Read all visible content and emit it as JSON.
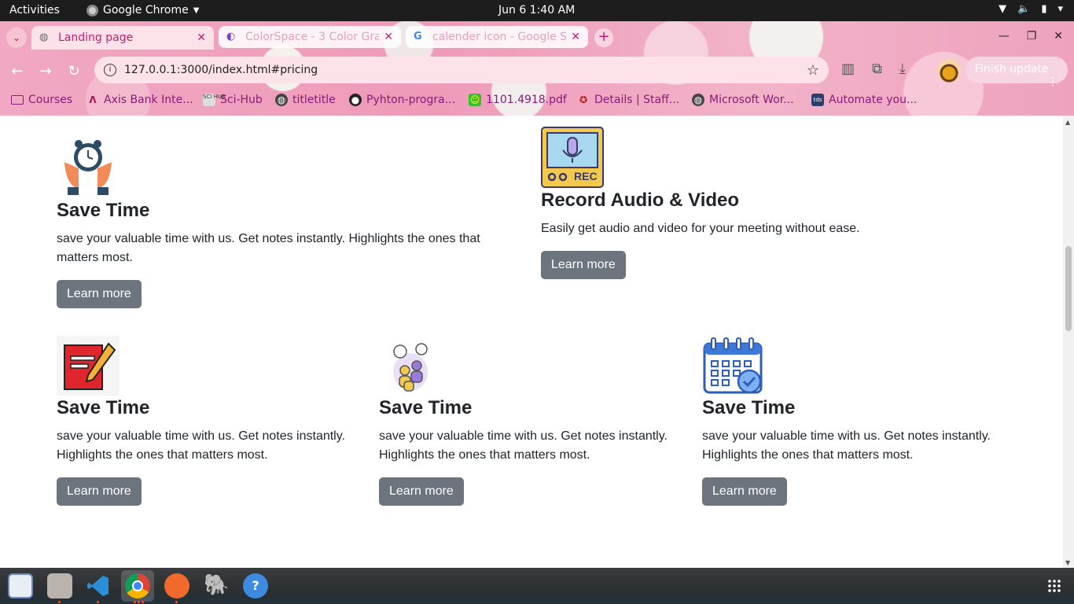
{
  "topbar": {
    "activities": "Activities",
    "app_name": "Google Chrome",
    "clock": "Jun 6   1:40 AM"
  },
  "tabs": [
    {
      "title": "Landing page",
      "favicon": "globe-icon",
      "active": true
    },
    {
      "title": "ColorSpace - 3 Color Gra",
      "favicon": "planet-icon",
      "active": false
    },
    {
      "title": "calender icon - Google S",
      "favicon": "google-icon",
      "active": false
    }
  ],
  "omnibox": {
    "url": "127.0.0.1:3000/index.html#pricing"
  },
  "finish_update": "Finish update",
  "bookmarks": [
    {
      "label": "Courses",
      "icon": "folder-icon"
    },
    {
      "label": "Axis Bank Inte...",
      "icon": "axis-icon"
    },
    {
      "label": "Sci-Hub",
      "icon": "scihub-icon"
    },
    {
      "label": "titletitle",
      "icon": "globe-icon"
    },
    {
      "label": "Pyhton-progra...",
      "icon": "github-icon"
    },
    {
      "label": "1101.4918.pdf",
      "icon": "smiley-icon"
    },
    {
      "label": "Details | Staff...",
      "icon": "emblem-icon"
    },
    {
      "label": "Microsoft Wor...",
      "icon": "globe-icon"
    },
    {
      "label": "Automate you...",
      "icon": "tds-icon"
    }
  ],
  "features": [
    {
      "title": "Save Time",
      "text": "save your valuable time with us. Get notes instantly. Highlights the ones that matters most.",
      "button": "Learn more",
      "icon": "alarm-clock-icon"
    },
    {
      "title": "Record Audio & Video",
      "text": "Easily get audio and video for your meeting without ease.",
      "button": "Learn more",
      "icon": "rec-microphone-icon",
      "rec_label": "REC"
    },
    {
      "title": "Save Time",
      "text": "save your valuable time with us. Get notes instantly. Highlights the ones that matters most.",
      "button": "Learn more",
      "icon": "notebook-pencil-icon"
    },
    {
      "title": "Save Time",
      "text": "save your valuable time with us. Get notes instantly. Highlights the ones that matters most.",
      "button": "Learn more",
      "icon": "people-chat-icon"
    },
    {
      "title": "Save Time",
      "text": "save your valuable time with us. Get notes instantly. Highlights the ones that matters most.",
      "button": "Learn more",
      "icon": "calendar-check-icon"
    }
  ],
  "colors": {
    "button": "#6c757d",
    "tab_text": "#c31c6e",
    "bookmark_text": "#8a1a7c"
  }
}
